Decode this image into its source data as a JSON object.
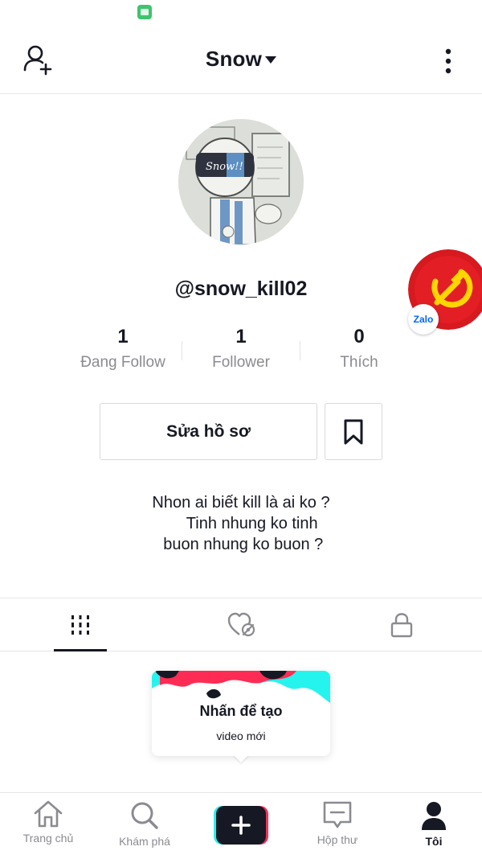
{
  "header": {
    "title": "Snow"
  },
  "profile": {
    "username": "@snow_kill02",
    "avatar_text": "Snow!!",
    "stats": [
      {
        "value": "1",
        "label": "Đang Follow"
      },
      {
        "value": "1",
        "label": "Follower"
      },
      {
        "value": "0",
        "label": "Thích"
      }
    ],
    "edit_label": "Sửa hồ sơ",
    "bio": "Nhon ai biết kill là ai ko ?\n     Tinh nhung ko tinh\n buon nhung ko buon ?"
  },
  "badge": {
    "zalo_label": "Zalo"
  },
  "create_card": {
    "title": "Nhấn để tạo",
    "subtitle": "video mới"
  },
  "nav": {
    "home": "Trang chủ",
    "discover": "Khám phá",
    "inbox": "Hộp thư",
    "me": "Tôi"
  },
  "colors": {
    "text": "#161823",
    "muted": "#8a8b91",
    "accent_red": "#fe2c55",
    "accent_cyan": "#25f4ee",
    "badge_red": "#d71920",
    "badge_gold": "#ffd600",
    "zalo_blue": "#0068ff"
  }
}
